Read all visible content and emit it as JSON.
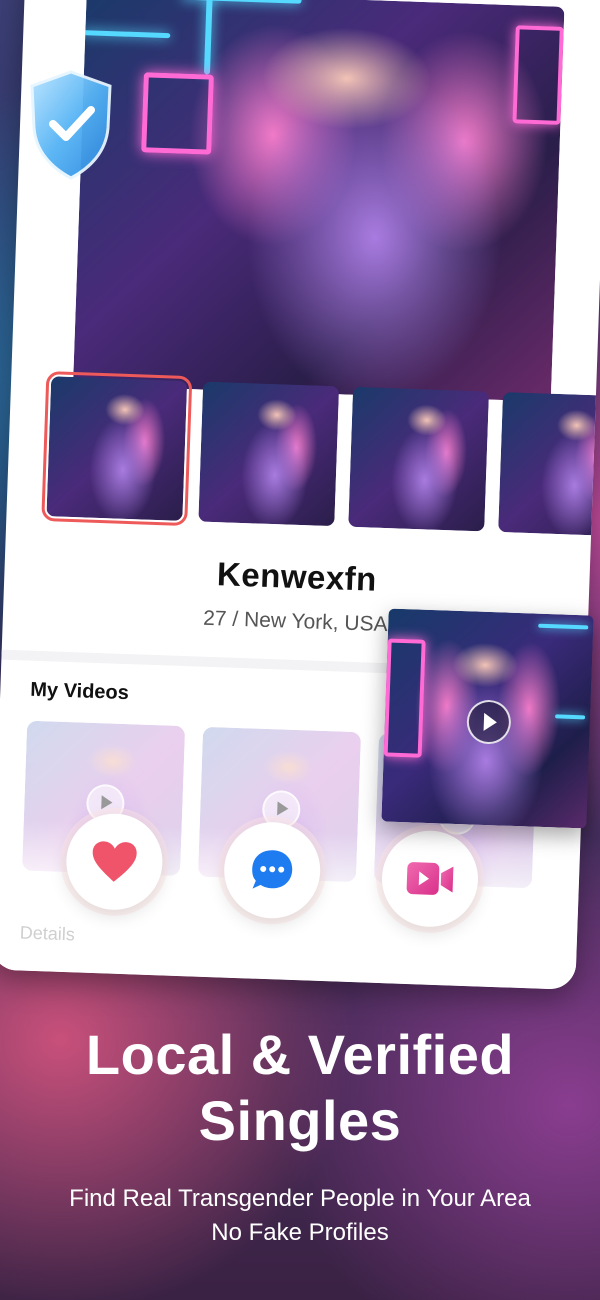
{
  "profile": {
    "name": "Kenwexfn",
    "location": "27 / New York, USA"
  },
  "videos_section": {
    "title": "My Videos"
  },
  "details_label": "Details",
  "actions": {
    "like_icon": "heart-icon",
    "message_icon": "chat-bubble-icon",
    "video_call_icon": "video-camera-icon"
  },
  "promo": {
    "headline_line1": "Local & Verified",
    "headline_line2": "Singles",
    "subtitle_line1": "Find Real Transgender People in Your Area",
    "subtitle_line2": "No Fake Profiles"
  },
  "colors": {
    "accent_red": "#ee5a5a",
    "heart": "#f0546a",
    "message": "#1f7cf0",
    "video_call": "#e9469a"
  }
}
